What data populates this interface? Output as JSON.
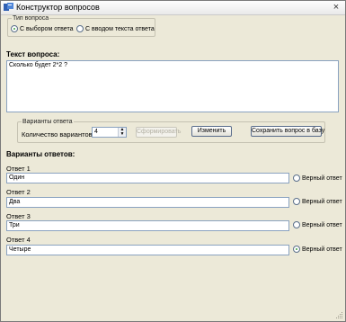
{
  "window": {
    "title": "Конструктор вопросов",
    "close_glyph": "×"
  },
  "question_type": {
    "legend": "Тип вопроса",
    "options": [
      {
        "label": "С выбором ответа",
        "selected": true
      },
      {
        "label": "С вводом текста ответа",
        "selected": false
      }
    ]
  },
  "question_text": {
    "label": "Текст вопроса:",
    "value": "Сколько будет 2*2 ?"
  },
  "answer_options": {
    "legend": "Варианты ответа",
    "count_label": "Количество вариантов:",
    "count_value": "4",
    "generate_button": "Сформировать",
    "change_button": "Изменить",
    "save_button": "Сохранить вопрос в базу"
  },
  "answers": {
    "header": "Варианты ответов:",
    "correct_label": "Верный ответ",
    "items": [
      {
        "label": "Ответ 1",
        "value": "Один",
        "correct": false
      },
      {
        "label": "Ответ 2",
        "value": "Два",
        "correct": false
      },
      {
        "label": "Ответ 3",
        "value": "Три",
        "correct": false
      },
      {
        "label": "Ответ 4",
        "value": "Четыре",
        "correct": true
      }
    ]
  }
}
